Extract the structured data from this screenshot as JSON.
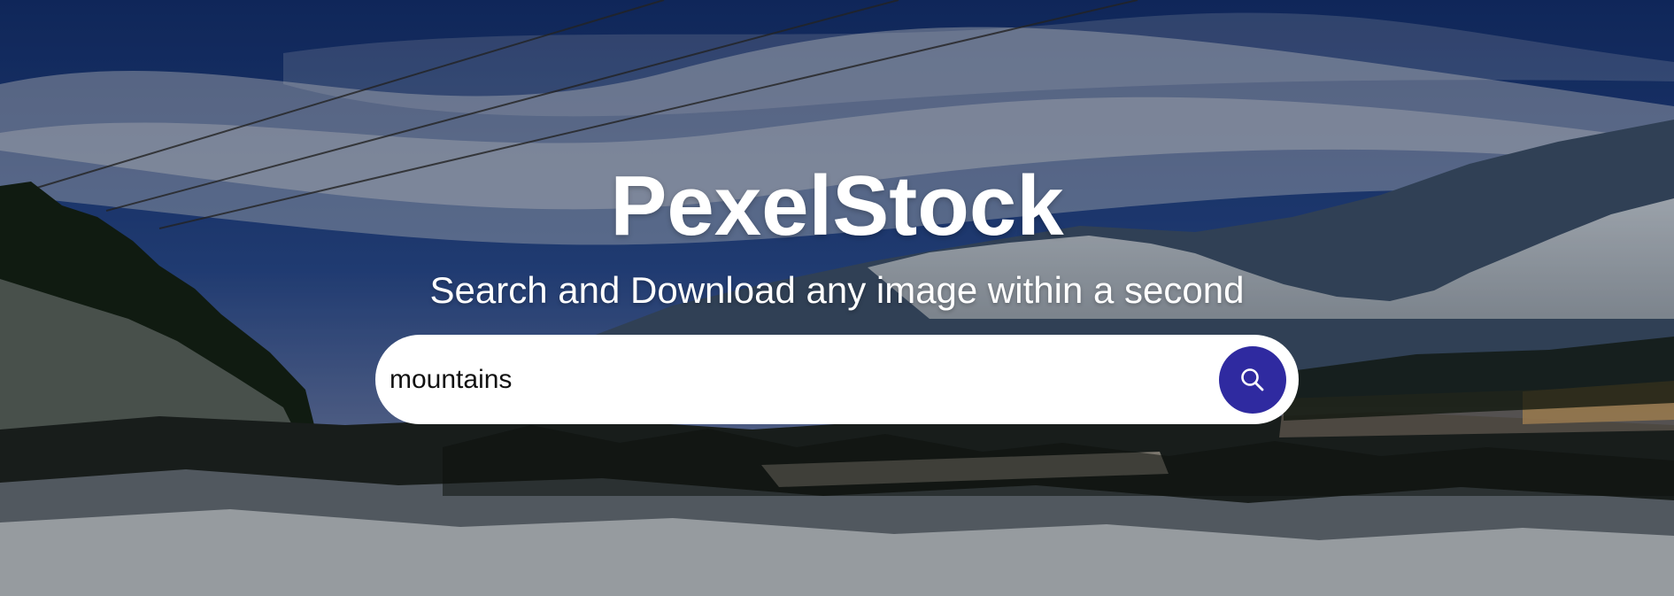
{
  "hero": {
    "title": "PexelStock",
    "subtitle": "Search and Download any image within a second",
    "background_image": "snowy-mountain-valley-landscape"
  },
  "search": {
    "value": "mountains",
    "placeholder": "",
    "button_icon": "search-icon",
    "button_color": "#2f2aa0"
  },
  "colors": {
    "text": "#ffffff",
    "input_background": "#ffffff",
    "accent": "#2f2aa0"
  }
}
